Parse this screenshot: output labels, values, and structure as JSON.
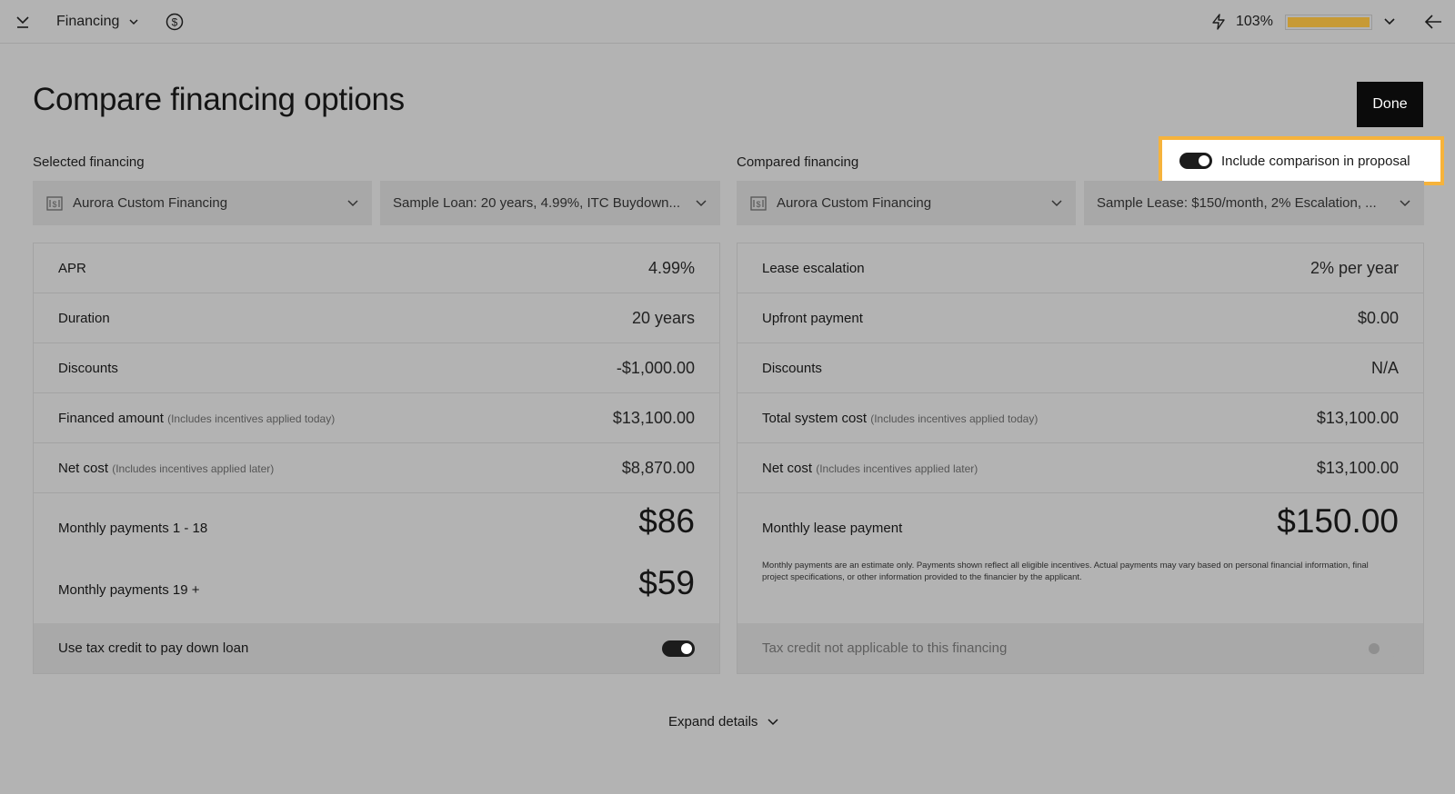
{
  "topbar": {
    "section_label": "Financing",
    "energy_offset": "103%",
    "energy_offset_fraction": 1.0,
    "accent_color": "#d9a63a"
  },
  "page": {
    "title": "Compare financing options",
    "done_label": "Done"
  },
  "selected": {
    "section_label": "Selected financing",
    "provider": "Aurora Custom Financing",
    "product": "Sample Loan: 20 years, 4.99%, ITC Buydown...",
    "rows": [
      {
        "label": "APR",
        "sub": "",
        "value": "4.99%"
      },
      {
        "label": "Duration",
        "sub": "",
        "value": "20 years"
      },
      {
        "label": "Discounts",
        "sub": "",
        "value": "-$1,000.00"
      },
      {
        "label": "Financed amount",
        "sub": "(Includes incentives applied today)",
        "value": "$13,100.00"
      },
      {
        "label": "Net cost",
        "sub": "(Includes incentives applied later)",
        "value": "$8,870.00"
      }
    ],
    "monthly_1_label": "Monthly payments 1 - 18",
    "monthly_1_value": "$86",
    "monthly_2_label": "Monthly payments 19 +",
    "monthly_2_value": "$59",
    "tax_label": "Use tax credit to pay down loan",
    "tax_on": true
  },
  "compared": {
    "section_label": "Compared financing",
    "include_label": "Include comparison in proposal",
    "include_on": true,
    "provider": "Aurora Custom Financing",
    "product": "Sample Lease: $150/month, 2% Escalation, ...",
    "rows": [
      {
        "label": "Lease escalation",
        "sub": "",
        "value": "2% per year"
      },
      {
        "label": "Upfront payment",
        "sub": "",
        "value": "$0.00"
      },
      {
        "label": "Discounts",
        "sub": "",
        "value": "N/A"
      },
      {
        "label": "Total system cost",
        "sub": "(Includes incentives applied today)",
        "value": "$13,100.00"
      },
      {
        "label": "Net cost",
        "sub": "(Includes incentives applied later)",
        "value": "$13,100.00"
      }
    ],
    "monthly_label": "Monthly lease payment",
    "monthly_value": "$150.00",
    "disclaimer": "Monthly payments are an estimate only. Payments shown reflect all eligible incentives. Actual payments may vary based on personal financial information, final project specifications, or other information provided to the financier by the applicant.",
    "tax_label": "Tax credit not applicable to this financing",
    "tax_on": false
  },
  "expand_label": "Expand details",
  "highlight_color": "#f6b33c"
}
